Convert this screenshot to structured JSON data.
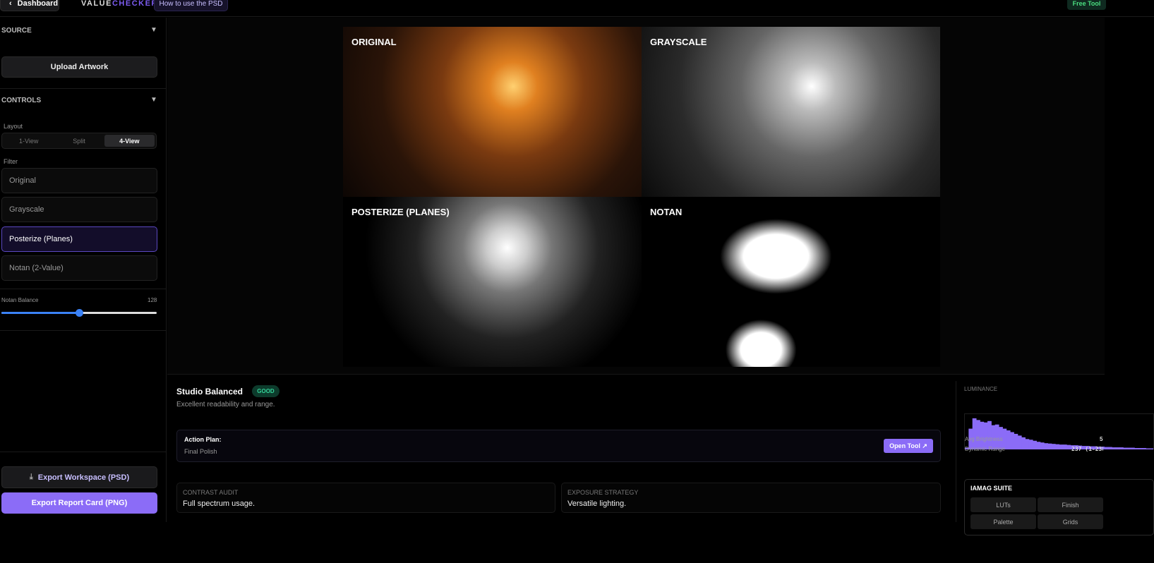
{
  "topbar": {
    "dashboard": "Dashboard",
    "logo_a": "VALUE",
    "logo_b": "CHECKER",
    "how_to": "How to use the PSD",
    "badge": "Free Tool"
  },
  "sidebar": {
    "source_header": "SOURCE",
    "upload": "Upload Artwork",
    "controls_header": "CONTROLS",
    "layout_label": "Layout",
    "layout_options": [
      "1-View",
      "Split",
      "4-View"
    ],
    "layout_selected": "4-View",
    "filter_label": "Filter",
    "filters": [
      "Original",
      "Grayscale",
      "Posterize (Planes)",
      "Notan (2-Value)"
    ],
    "filter_selected": "Posterize (Planes)",
    "notan_label": "Notan Balance",
    "notan_value": "128",
    "notan_fraction": 0.5,
    "export_psd": "Export Workspace (PSD)",
    "export_png": "Export Report Card (PNG)"
  },
  "viewer": {
    "panels": [
      "ORIGINAL",
      "GRAYSCALE",
      "POSTERIZE (PLANES)",
      "NOTAN"
    ]
  },
  "report": {
    "title": "Studio Balanced",
    "badge": "GOOD",
    "subtitle": "Excellent readability and range.",
    "action_label": "Action Plan:",
    "action_value": "Final Polish",
    "open_tool": "Open Tool ↗",
    "contrast_h": "CONTRAST AUDIT",
    "contrast_v": "Full spectrum usage.",
    "exposure_h": "EXPOSURE STRATEGY",
    "exposure_v": "Versatile lighting."
  },
  "luminance": {
    "title": "LUMINANCE",
    "avg_label": "Avg Brightness",
    "avg_value": "5",
    "range_label": "Dynamic Range",
    "range_value": "237 (1-238",
    "histogram": [
      5,
      60,
      90,
      85,
      80,
      78,
      82,
      70,
      72,
      65,
      60,
      55,
      50,
      45,
      40,
      35,
      30,
      28,
      25,
      22,
      20,
      18,
      17,
      16,
      15,
      14,
      14,
      13,
      12,
      12,
      11,
      10,
      10,
      9,
      9,
      8,
      8,
      7,
      7,
      6,
      6,
      6,
      5,
      5,
      5,
      4,
      4,
      4,
      3,
      3
    ]
  },
  "suite": {
    "title": "IAMAG SUITE",
    "buttons": [
      "LUTs",
      "Finish",
      "Palette",
      "Grids"
    ]
  },
  "colors": {
    "accent": "#8b6cf7",
    "good": "#34d399",
    "slider": "#3b82f6"
  }
}
